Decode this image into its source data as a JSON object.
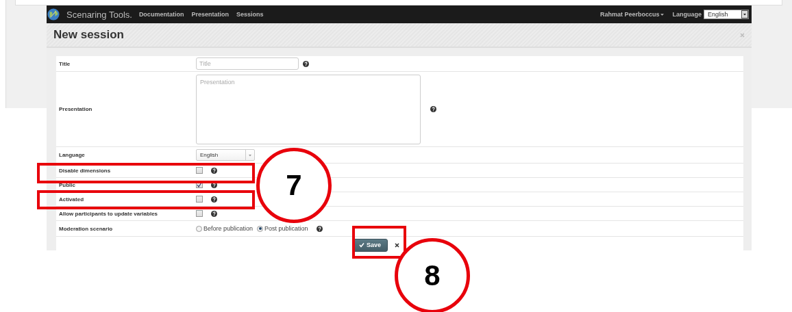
{
  "navbar": {
    "brand": "Scenaring Tools.",
    "links": [
      "Documentation",
      "Presentation",
      "Sessions"
    ],
    "user": "Rahmat Peerboccus",
    "language_label": "Language",
    "language_value": "English"
  },
  "page_title": "New session",
  "form": {
    "rows": [
      {
        "kind": "text",
        "label": "Title",
        "placeholder": "Title",
        "help": true
      },
      {
        "kind": "textarea",
        "label": "Presentation",
        "placeholder": "Presentation",
        "help": true
      },
      {
        "kind": "select",
        "label": "Language",
        "value": "English",
        "help": false
      },
      {
        "kind": "checkbox",
        "label": "Disable dimensions",
        "checked": false,
        "help": true
      },
      {
        "kind": "checkbox",
        "label": "Public",
        "checked": true,
        "help": true
      },
      {
        "kind": "checkbox",
        "label": "Activated",
        "checked": false,
        "help": true
      },
      {
        "kind": "checkbox",
        "label": "Allow participants to update variables",
        "checked": false,
        "help": true
      },
      {
        "kind": "radio",
        "label": "Moderation scenario",
        "options": [
          {
            "label": "Before publication",
            "selected": false
          },
          {
            "label": "Post publication",
            "selected": true
          }
        ],
        "help": true
      }
    ],
    "save_button": "Save"
  },
  "annotations": [
    {
      "kind": "box"
    },
    {
      "kind": "box"
    },
    {
      "kind": "callout",
      "number": "7"
    },
    {
      "kind": "box"
    },
    {
      "kind": "callout",
      "number": "8"
    }
  ]
}
